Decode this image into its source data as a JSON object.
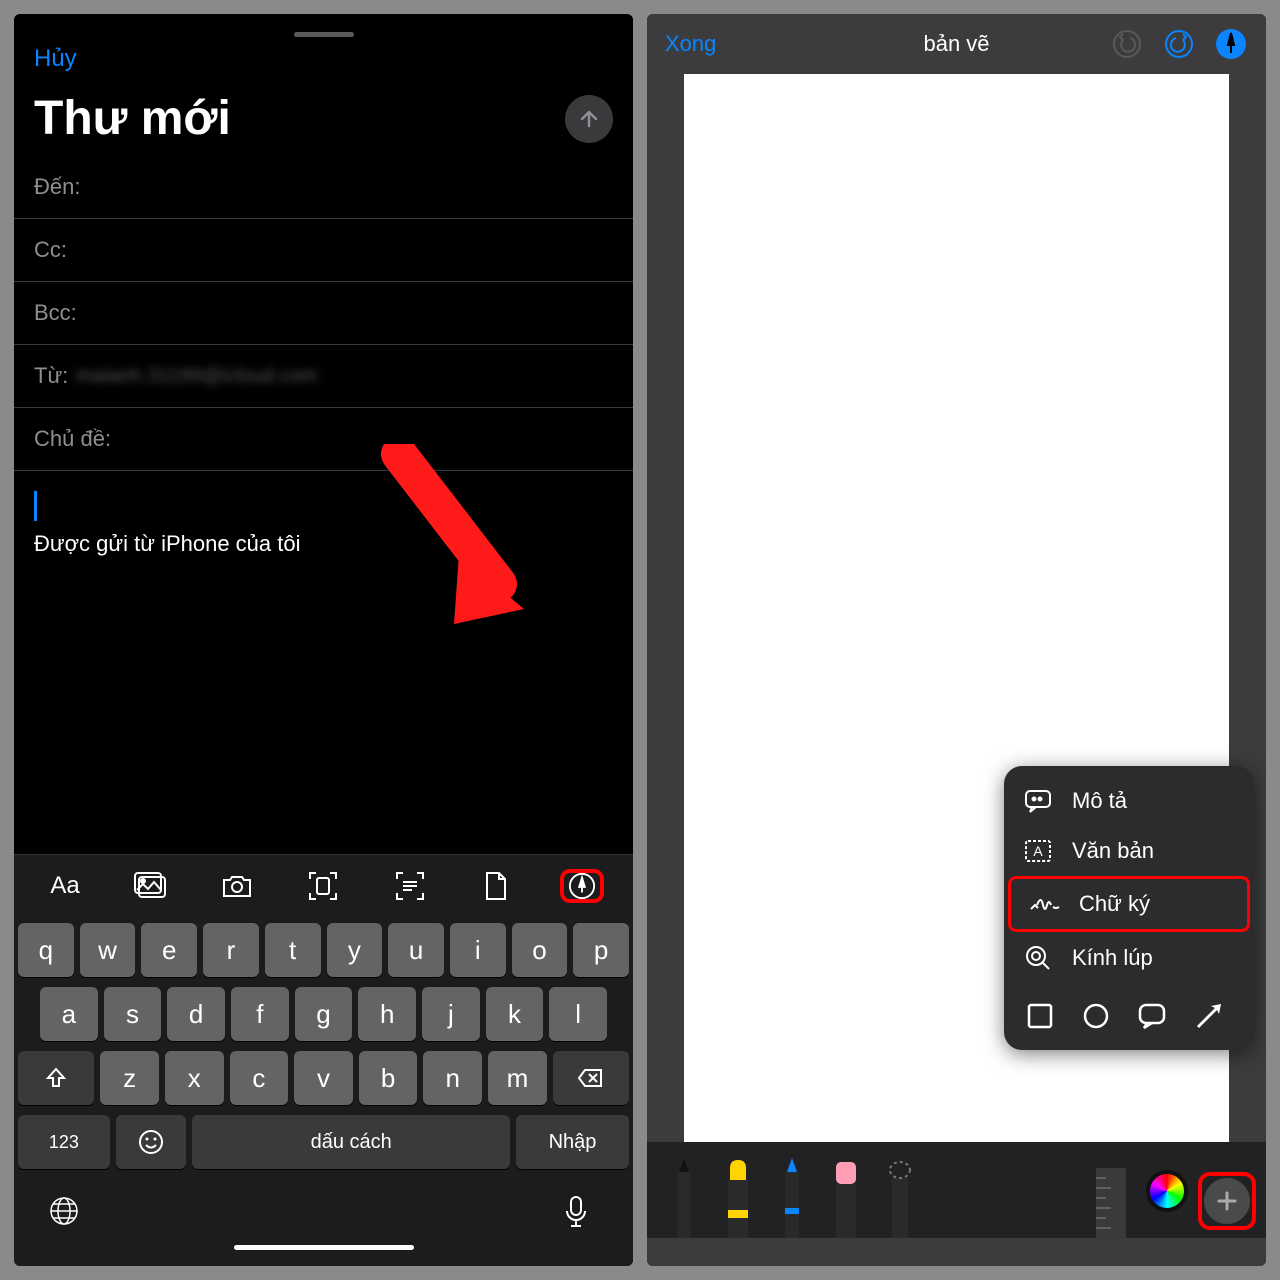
{
  "left": {
    "cancel": "Hủy",
    "title": "Thư mới",
    "fields": {
      "to": "Đến:",
      "cc": "Cc:",
      "bcc": "Bcc:",
      "from_label": "Từ:",
      "from_value": "maianh.31199@icloud.com",
      "subject": "Chủ đề:"
    },
    "signature": "Được gửi từ iPhone của tôi",
    "toolbar": {
      "text_format": "Aa"
    },
    "keyboard": {
      "row1": [
        "q",
        "w",
        "e",
        "r",
        "t",
        "y",
        "u",
        "i",
        "o",
        "p"
      ],
      "row2": [
        "a",
        "s",
        "d",
        "f",
        "g",
        "h",
        "j",
        "k",
        "l"
      ],
      "row3": [
        "z",
        "x",
        "c",
        "v",
        "b",
        "n",
        "m"
      ],
      "numbers": "123",
      "space": "dấu cách",
      "enter": "Nhập"
    }
  },
  "right": {
    "done": "Xong",
    "title": "bản vẽ",
    "popup": {
      "describe": "Mô tả",
      "text": "Văn bản",
      "signature": "Chữ ký",
      "magnifier": "Kính lúp"
    }
  }
}
